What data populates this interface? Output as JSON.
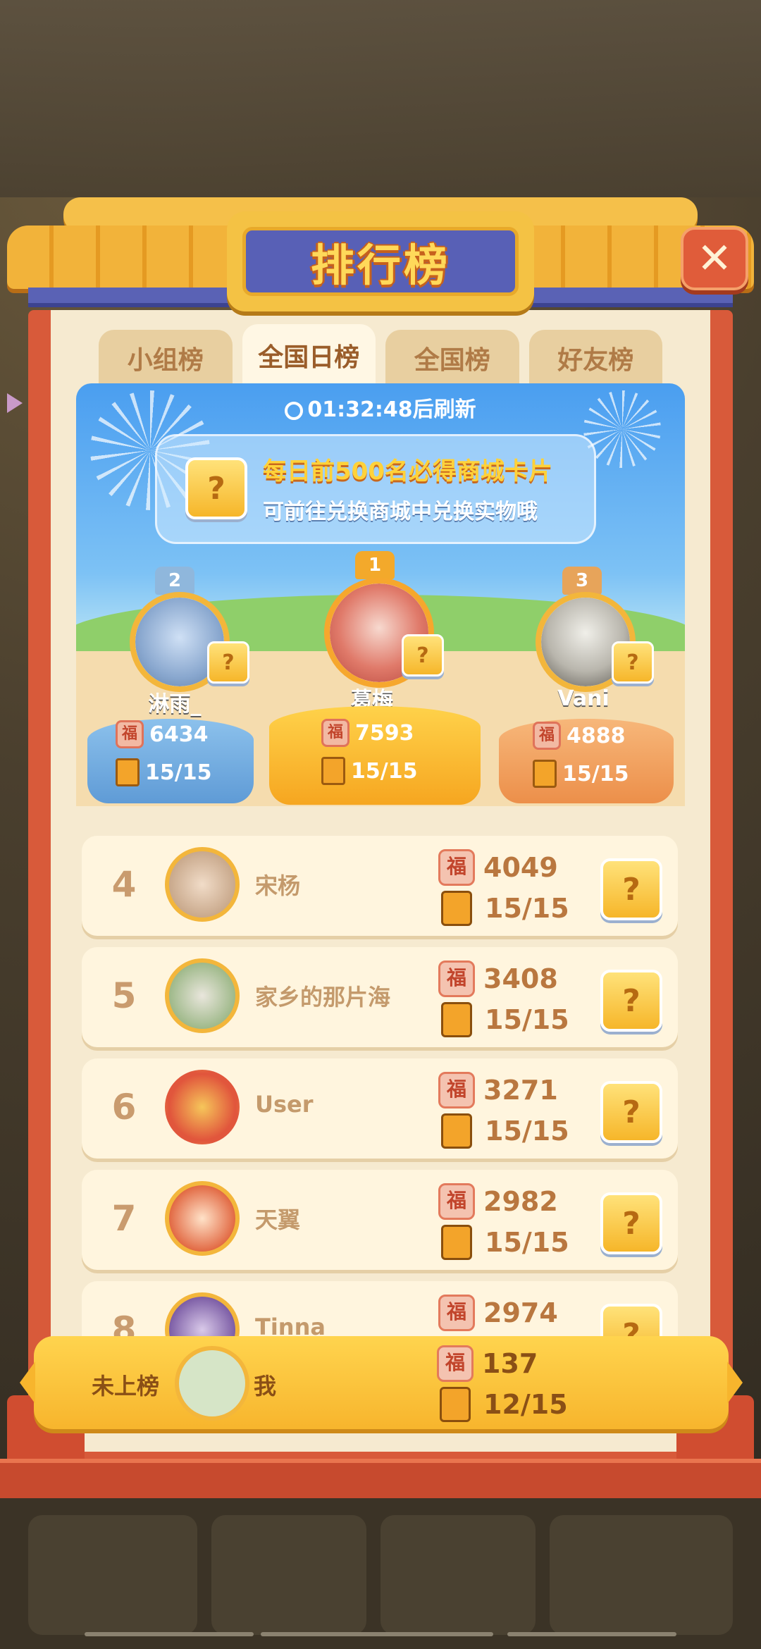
{
  "title": "排行榜",
  "close_icon": "close-icon",
  "tabs": [
    {
      "label": "小组榜",
      "active": false
    },
    {
      "label": "全国日榜",
      "active": true
    },
    {
      "label": "全国榜",
      "active": false
    },
    {
      "label": "好友榜",
      "active": false
    }
  ],
  "timer": {
    "time": "01:32:48",
    "suffix": "后刷新"
  },
  "banner": {
    "line1": "每日前500名必得商城卡片",
    "line2": "可前往兑换商城中兑换实物哦",
    "card_glyph": "?"
  },
  "top3": [
    {
      "rank": "1",
      "name": "葛梅",
      "score": "7593",
      "progress": "15/15"
    },
    {
      "rank": "2",
      "name": "淋雨_",
      "score": "6434",
      "progress": "15/15"
    },
    {
      "rank": "3",
      "name": "Vani",
      "score": "4888",
      "progress": "15/15"
    }
  ],
  "rows": [
    {
      "rank": "4",
      "name": "宋杨",
      "score": "4049",
      "progress": "15/15"
    },
    {
      "rank": "5",
      "name": "家乡的那片海",
      "score": "3408",
      "progress": "15/15"
    },
    {
      "rank": "6",
      "name": "User",
      "score": "3271",
      "progress": "15/15"
    },
    {
      "rank": "7",
      "name": "天翼",
      "score": "2982",
      "progress": "15/15"
    },
    {
      "rank": "8",
      "name": "Tinna",
      "score": "2974",
      "progress": ""
    }
  ],
  "me": {
    "status": "未上榜",
    "name": "我",
    "score": "137",
    "progress": "12/15"
  },
  "fu_glyph": "福",
  "colors": {
    "accent": "#f7b52d",
    "frame": "#d85a3a",
    "title_bg": "#5860b6"
  }
}
